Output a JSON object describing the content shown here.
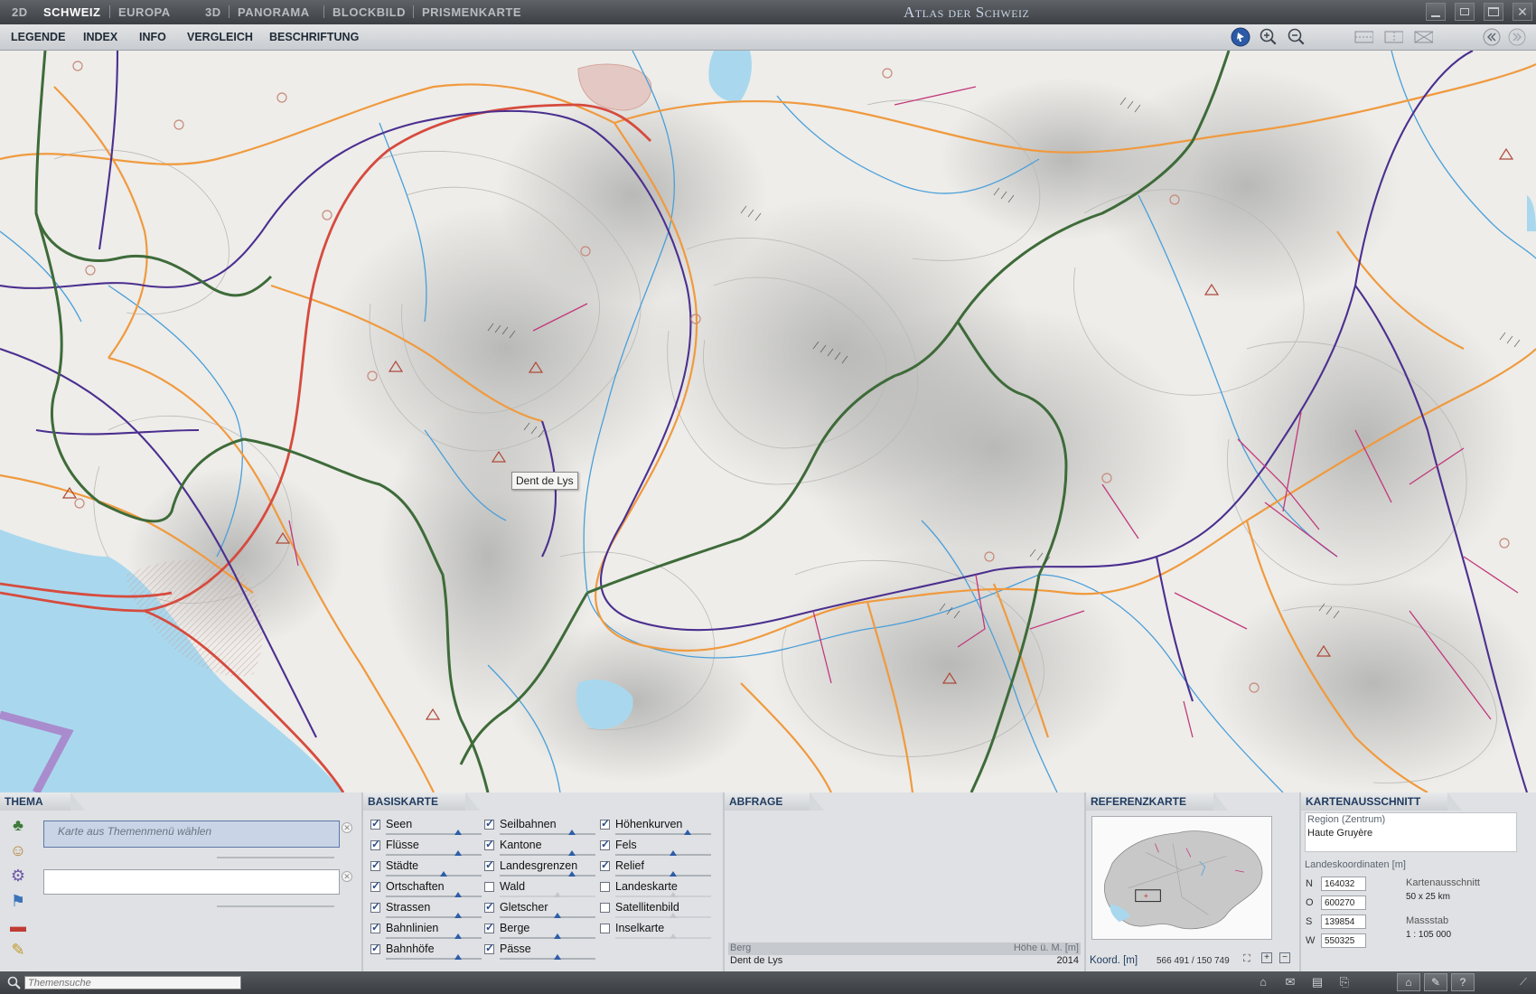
{
  "titlebar": {
    "modes": [
      {
        "label": "2D",
        "active": false
      },
      {
        "label": "SCHWEIZ",
        "active": true
      },
      {
        "label": "EUROPA",
        "active": false
      },
      {
        "label": "3D",
        "active": false
      },
      {
        "label": "PANORAMA",
        "active": false
      },
      {
        "label": "BLOCKBILD",
        "active": false
      },
      {
        "label": "PRISMENKARTE",
        "active": false
      }
    ],
    "app_title": "Atlas der Schweiz"
  },
  "menu": {
    "items": [
      "LEGENDE",
      "INDEX",
      "INFO",
      "VERGLEICH",
      "BESCHRIFTUNG"
    ]
  },
  "map": {
    "tooltip": "Dent de Lys",
    "colors": {
      "lake": "#a9d8ee",
      "river": "#4a9fd8",
      "road_main": "#d64b3e",
      "road": "#f09a3e",
      "rail": "#4b2f8f",
      "canton_border": "#3e6b39",
      "cableway": "#c2377a"
    }
  },
  "thema": {
    "tab": "THEMA",
    "placeholder": "Karte aus Themenmenü wählen",
    "icons": [
      "tree-icon",
      "people-icon",
      "gear-icon",
      "flag-icon",
      "train-icon",
      "tools-icon"
    ]
  },
  "basiskarte": {
    "tab": "BASISKARTE",
    "columns": [
      [
        {
          "label": "Seen",
          "checked": true,
          "level": 0.75
        },
        {
          "label": "Flüsse",
          "checked": true,
          "level": 0.75
        },
        {
          "label": "Städte",
          "checked": true,
          "level": 0.6
        },
        {
          "label": "Ortschaften",
          "checked": true,
          "level": 0.75
        },
        {
          "label": "Strassen",
          "checked": true,
          "level": 0.75
        },
        {
          "label": "Bahnlinien",
          "checked": true,
          "level": 0.75
        },
        {
          "label": "Bahnhöfe",
          "checked": true,
          "level": 0.75
        }
      ],
      [
        {
          "label": "Seilbahnen",
          "checked": true,
          "level": 0.75
        },
        {
          "label": "Kantone",
          "checked": true,
          "level": 0.75
        },
        {
          "label": "Landesgrenzen",
          "checked": true,
          "level": 0.75
        },
        {
          "label": "Wald",
          "checked": false,
          "level": 0.6
        },
        {
          "label": "Gletscher",
          "checked": true,
          "level": 0.6
        },
        {
          "label": "Berge",
          "checked": true,
          "level": 0.6
        },
        {
          "label": "Pässe",
          "checked": true,
          "level": 0.6
        }
      ],
      [
        {
          "label": "Höhenkurven",
          "checked": true,
          "level": 0.75
        },
        {
          "label": "Fels",
          "checked": true,
          "level": 0.6
        },
        {
          "label": "Relief",
          "checked": true,
          "level": 0.6
        },
        {
          "label": "Landeskarte",
          "checked": false,
          "level": 0.6
        },
        {
          "label": "Satellitenbild",
          "checked": false,
          "level": 0.6
        },
        {
          "label": "Inselkarte",
          "checked": false,
          "level": 0.6
        }
      ]
    ]
  },
  "abfrage": {
    "tab": "ABFRAGE",
    "header_left": "Berg",
    "header_right": "Höhe ü. M. [m]",
    "value_left": "Dent de Lys",
    "value_right": "2014"
  },
  "referenz": {
    "tab": "REFERENZKARTE",
    "coord_label": "Koord. [m]",
    "coord_value": "566 491 / 150 749"
  },
  "ausschnitt": {
    "tab": "KARTENAUSSCHNITT",
    "region_label": "Region (Zentrum)",
    "region_value": "Haute Gruyère",
    "coords_label": "Landeskoordinaten [m]",
    "coords": [
      {
        "key": "N",
        "value": "164032"
      },
      {
        "key": "O",
        "value": "600270"
      },
      {
        "key": "S",
        "value": "139854"
      },
      {
        "key": "W",
        "value": "550325"
      }
    ],
    "extent_label": "Kartenausschnitt",
    "extent_value": "50 x 25 km",
    "scale_label": "Massstab",
    "scale_value": "1 : 105 000"
  },
  "statusbar": {
    "search_placeholder": "Themensuche"
  }
}
